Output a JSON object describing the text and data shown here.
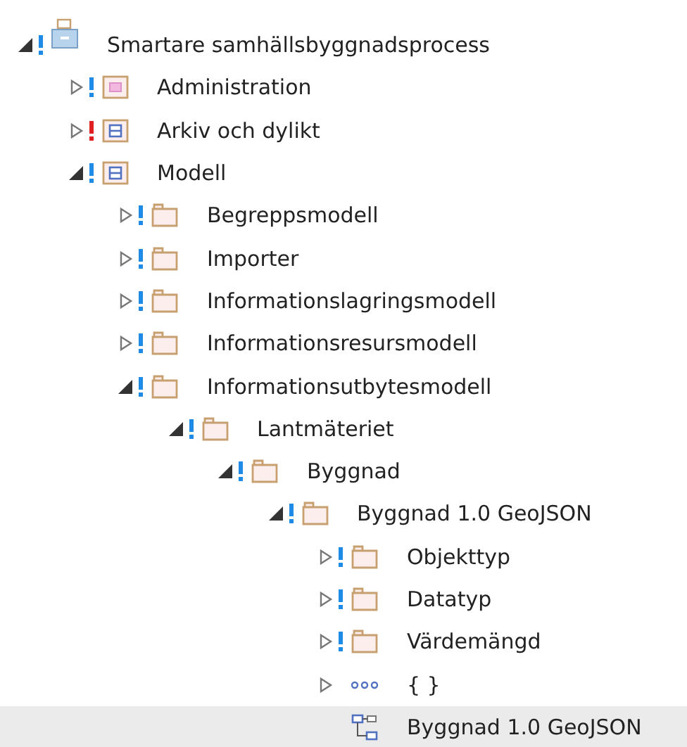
{
  "tree": [
    {
      "label": "Smartare samhällsbyggnadsprocess",
      "kind": "root",
      "warning": true,
      "color": "#1e8ce6",
      "expanded": true,
      "selected": false,
      "children": [
        {
          "label": "Administration",
          "kind": "pink",
          "warning": true,
          "color": "#1e8ce6",
          "expanded": false,
          "selected": false
        },
        {
          "label": "Arkiv och dylikt",
          "kind": "blue",
          "warning": true,
          "color": "#e02020",
          "expanded": false,
          "selected": false
        },
        {
          "label": "Modell",
          "kind": "blue",
          "warning": true,
          "color": "#1e8ce6",
          "expanded": true,
          "selected": false,
          "children": [
            {
              "label": "Begreppsmodell",
              "kind": "folder",
              "warning": true,
              "color": "#1e8ce6",
              "expanded": false,
              "selected": false
            },
            {
              "label": "Importer",
              "kind": "folder",
              "warning": true,
              "color": "#1e8ce6",
              "expanded": false,
              "selected": false
            },
            {
              "label": "Informationslagringsmodell",
              "kind": "folder",
              "warning": true,
              "color": "#1e8ce6",
              "expanded": false,
              "selected": false
            },
            {
              "label": "Informationsresursmodell",
              "kind": "folder",
              "warning": true,
              "color": "#1e8ce6",
              "expanded": false,
              "selected": false
            },
            {
              "label": "Informationsutbytesmodell",
              "kind": "folder",
              "warning": true,
              "color": "#1e8ce6",
              "expanded": true,
              "selected": false,
              "children": [
                {
                  "label": "Lantmäteriet",
                  "kind": "folder",
                  "warning": true,
                  "color": "#1e8ce6",
                  "expanded": true,
                  "selected": false,
                  "children": [
                    {
                      "label": "Byggnad",
                      "kind": "folder",
                      "warning": true,
                      "color": "#1e8ce6",
                      "expanded": true,
                      "selected": false,
                      "children": [
                        {
                          "label": "Byggnad 1.0 GeoJSON",
                          "kind": "folder",
                          "warning": true,
                          "color": "#1e8ce6",
                          "expanded": true,
                          "selected": false,
                          "children": [
                            {
                              "label": "Objekttyp",
                              "kind": "folder",
                              "warning": true,
                              "color": "#1e8ce6",
                              "expanded": false,
                              "selected": false
                            },
                            {
                              "label": "Datatyp",
                              "kind": "folder",
                              "warning": true,
                              "color": "#1e8ce6",
                              "expanded": false,
                              "selected": false
                            },
                            {
                              "label": "Värdemängd",
                              "kind": "folder",
                              "warning": true,
                              "color": "#1e8ce6",
                              "expanded": false,
                              "selected": false
                            },
                            {
                              "label": "{ }",
                              "kind": "dots",
                              "warning": false,
                              "expanded": false,
                              "selected": false
                            },
                            {
                              "label": "Byggnad 1.0 GeoJSON",
                              "kind": "diagram",
                              "warning": false,
                              "selected": true
                            }
                          ]
                        }
                      ]
                    }
                  ]
                }
              ]
            }
          ]
        }
      ]
    }
  ]
}
